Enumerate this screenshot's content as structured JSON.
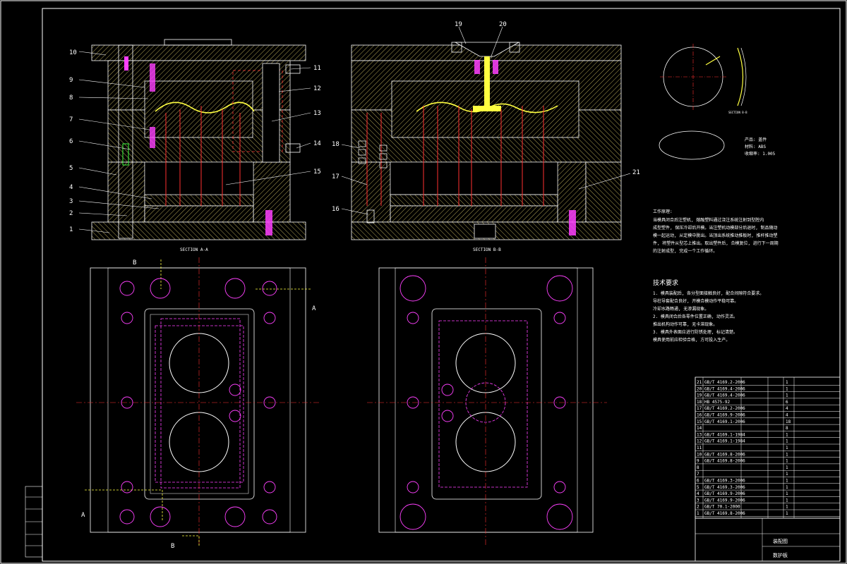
{
  "colors": {
    "background": "#000000",
    "outline": "#ffffff",
    "hatch": "#d4c060",
    "part_yellow": "#ffff40",
    "magenta": "#ff40ff",
    "red": "#ff3030",
    "green": "#40ff40"
  },
  "section_aa": {
    "caption": "SECTION A-A",
    "balloons": [
      "10",
      "9",
      "8",
      "7",
      "6",
      "5",
      "4",
      "3",
      "2",
      "1",
      "11",
      "12",
      "13",
      "14",
      "15"
    ]
  },
  "section_bb": {
    "caption": "SECTION B-B",
    "balloons": [
      "19",
      "20",
      "18",
      "17",
      "16",
      "21"
    ]
  },
  "product": {
    "detail_caption": "SECTION B-B",
    "name": "产品: 盖件",
    "material": "材料: ABS",
    "shrinkage": "收缩率: 1.005"
  },
  "working_principle": {
    "title": "工作原理:",
    "lines": [
      "当模具闭合后注塑机, 熔融塑料通过浇注系统注射到型腔内",
      "成型塑件, 保压冷却后开模。当注塑机动模部分后退时, 制品随动",
      "模一起运动, 从定模中脱出。当顶出系统推动推板时, 推杆推动塑",
      "件, 将塑件从型芯上推出。取出塑件后, 合模复位, 进行下一周期",
      "的注射成型, 完成一个工作循环。"
    ]
  },
  "technical_requirements": {
    "title": "技术要求",
    "lines": [
      "1. 模具装配后, 各分型面接触良好, 配合间隙符合要求。",
      "   导柱导套配合良好, 开模合模动作平稳可靠。",
      "   冷却水路畅通, 无渗漏现象。",
      "2. 模具闭合后各零件位置正确, 动作灵活。",
      "   推出机构动作可靠, 无卡滞现象。",
      "3. 模具外表面应进行防锈处理, 标记清楚。",
      "   模具使用前应检验合格, 方可投入生产。"
    ]
  },
  "section_markers": [
    "A",
    "A",
    "B",
    "B"
  ],
  "parts_list": [
    {
      "no": "21",
      "code": "GB/T 4169.2-2006",
      "qty": "1"
    },
    {
      "no": "20",
      "code": "GB/T 4169.4-2006",
      "qty": "1"
    },
    {
      "no": "19",
      "code": "GB/T 4169.4-2006",
      "qty": "1"
    },
    {
      "no": "18",
      "code": "HB 4575-92",
      "qty": "6"
    },
    {
      "no": "17",
      "code": "GB/T 4169.2-2006",
      "qty": "4"
    },
    {
      "no": "16",
      "code": "GB/T 4169.9-2006",
      "qty": "4"
    },
    {
      "no": "15",
      "code": "GB/T 4169.1-2006",
      "qty": "18"
    },
    {
      "no": "14",
      "code": "",
      "qty": "8"
    },
    {
      "no": "13",
      "code": "GB/T 4169.1-1984",
      "qty": "1"
    },
    {
      "no": "12",
      "code": "GB/T 4169.1-1984",
      "qty": "1"
    },
    {
      "no": "11",
      "code": "",
      "qty": "1"
    },
    {
      "no": "10",
      "code": "GB/T 4169.8-2006",
      "qty": "1"
    },
    {
      "no": "9",
      "code": "GB/T 4169.8-2006",
      "qty": "1"
    },
    {
      "no": "8",
      "code": "",
      "qty": "1"
    },
    {
      "no": "7",
      "code": "",
      "qty": "1"
    },
    {
      "no": "6",
      "code": "GB/T 4169.3-2006",
      "qty": "1"
    },
    {
      "no": "5",
      "code": "GB/T 4169.3-2006",
      "qty": "1"
    },
    {
      "no": "4",
      "code": "GB/T 4169.9-2006",
      "qty": "1"
    },
    {
      "no": "3",
      "code": "GB/T 4169.9-2006",
      "qty": "1"
    },
    {
      "no": "2",
      "code": "GB/T 70.1-2000",
      "qty": "1"
    },
    {
      "no": "1",
      "code": "GB/T 4169.8-2006",
      "qty": "1"
    }
  ],
  "title_block": {
    "name": "装配图",
    "company": "数护板"
  }
}
